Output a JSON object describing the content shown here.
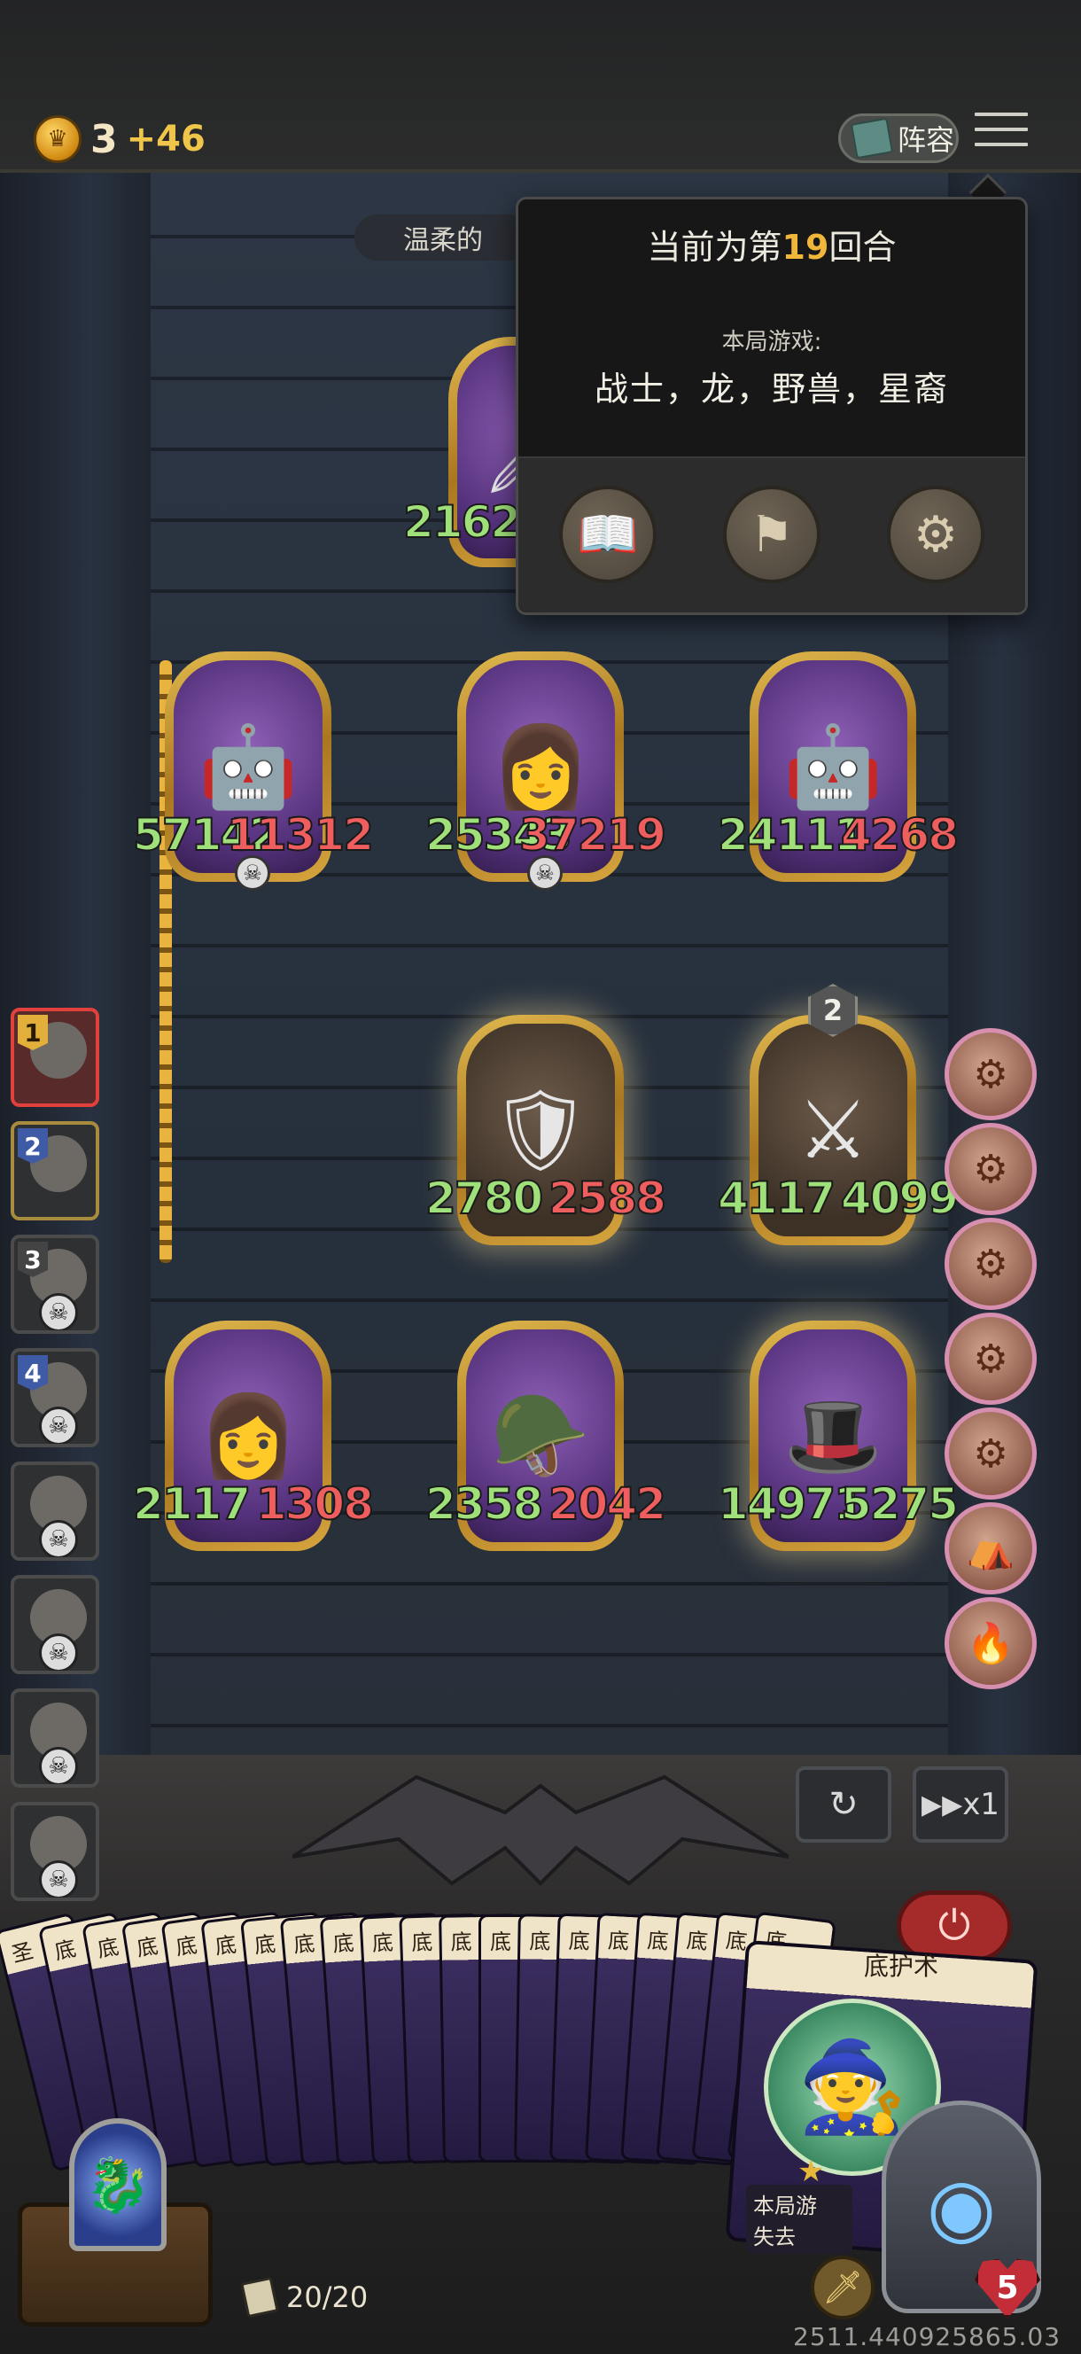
{
  "topbar": {
    "gold_amount": "3",
    "gold_income": "+46",
    "lineup_label": "阵容"
  },
  "opponent": {
    "name_partial": "温柔的"
  },
  "popup": {
    "round_prefix": "当前为第",
    "round_number": "19",
    "round_suffix": "回合",
    "game_label": "本局游戏:",
    "tribes": "战士，龙，野兽，星裔"
  },
  "board": {
    "top_unit": {
      "atk": "2162",
      "hp": ""
    },
    "enemy_row": [
      {
        "atk": "57142",
        "hp": "11312",
        "icon": "robot-icon"
      },
      {
        "atk": "25343",
        "hp": "37219",
        "icon": "engineer-icon"
      },
      {
        "atk": "24111",
        "hp": "4268",
        "icon": "robot-icon"
      }
    ],
    "mid_row": [
      {
        "atk": "2780",
        "hp": "2588",
        "icon": "warrior-icon"
      },
      {
        "atk": "4117",
        "hp": "4099",
        "icon": "knight-icon",
        "level": "2"
      }
    ],
    "bottom_row": [
      {
        "atk": "2117",
        "hp": "1308",
        "icon": "engineer-icon"
      },
      {
        "atk": "2358",
        "hp": "2042",
        "icon": "paladin-icon"
      },
      {
        "atk": "14971",
        "hp": "5275",
        "icon": "rogue-icon"
      }
    ]
  },
  "opponents_list": [
    {
      "rank": "1"
    },
    {
      "rank": "2"
    },
    {
      "rank": "3"
    },
    {
      "rank": "4"
    },
    {
      "rank": ""
    },
    {
      "rank": ""
    },
    {
      "rank": ""
    },
    {
      "rank": ""
    }
  ],
  "controls": {
    "speed_label": "x1"
  },
  "deck": {
    "card_labels": [
      "圣",
      "底",
      "底",
      "底",
      "底",
      "底",
      "底",
      "底",
      "底",
      "底",
      "底",
      "底",
      "底",
      "底",
      "底",
      "底",
      "底",
      "底",
      "底",
      "底"
    ],
    "featured_card_label": "底护术",
    "featured_card_note": "本局游\n失去",
    "count_text": "20/20"
  },
  "player": {
    "health": "5"
  },
  "build_id": "2511.440925865.03"
}
